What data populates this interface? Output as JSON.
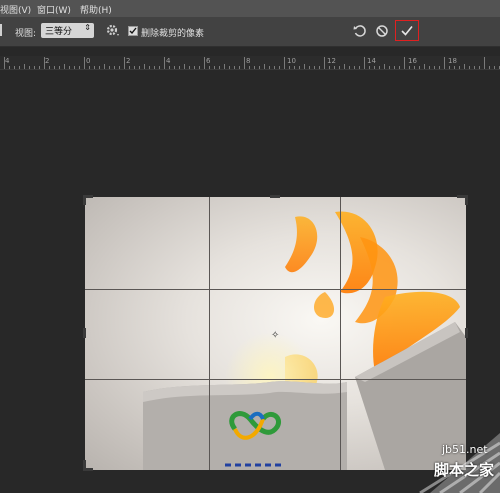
{
  "menubar": {
    "items": [
      "视图(V)",
      "窗口(W)",
      "帮助(H)"
    ]
  },
  "options": {
    "view_label": "视图:",
    "view_value": "三等分",
    "delete_cropped_label": "删除裁剪的像素",
    "delete_cropped_checked": true
  },
  "ruler": {
    "labels": [
      "4",
      "2",
      "0",
      "2",
      "4",
      "6",
      "8",
      "10",
      "12",
      "14",
      "16",
      "18"
    ]
  },
  "icons": {
    "reset": "reset-icon",
    "cancel": "cancel-icon",
    "commit": "checkmark-icon",
    "gear": "gear-icon"
  },
  "watermark": {
    "url": "jb51.net",
    "text": "脚本之家"
  },
  "colors": {
    "commit_highlight": "#e02020"
  }
}
